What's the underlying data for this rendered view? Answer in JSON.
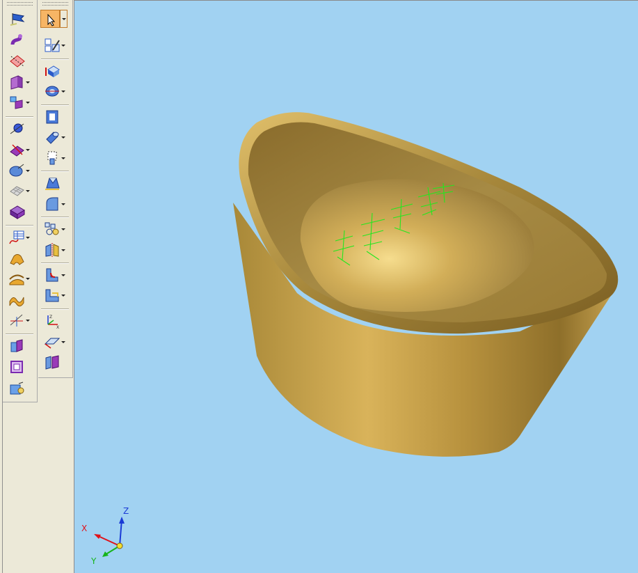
{
  "toolbar_left": {
    "tools": [
      {
        "name": "sketch-flag-icon"
      },
      {
        "name": "curve-tool-icon"
      },
      {
        "name": "plane-surface-icon"
      },
      {
        "name": "extrude-surface-icon"
      },
      {
        "name": "sweep-surface-icon"
      },
      {
        "name": "point-sphere-icon"
      },
      {
        "name": "trim-surface-icon"
      },
      {
        "name": "ellipsoid-icon"
      },
      {
        "name": "mesh-surface-icon"
      },
      {
        "name": "solid-block-icon"
      },
      {
        "name": "table-curve-icon"
      },
      {
        "name": "blend-surface-icon"
      },
      {
        "name": "offset-surface-icon"
      },
      {
        "name": "wave-surface-icon"
      },
      {
        "name": "line-construct-icon"
      },
      {
        "name": "split-face-icon"
      },
      {
        "name": "frame-face-icon"
      },
      {
        "name": "attach-face-icon"
      }
    ]
  },
  "toolbar_right": {
    "tools": [
      {
        "name": "select-arrow-icon"
      },
      {
        "name": "layout-sketch-icon"
      },
      {
        "name": "box-solid-icon"
      },
      {
        "name": "revolve-icon"
      },
      {
        "name": "shell-icon"
      },
      {
        "name": "cylinder-icon"
      },
      {
        "name": "hole-icon"
      },
      {
        "name": "loft-icon"
      },
      {
        "name": "draft-face-icon"
      },
      {
        "name": "pattern-icon"
      },
      {
        "name": "mirror-icon"
      },
      {
        "name": "fillet-corner-icon"
      },
      {
        "name": "chamfer-icon"
      },
      {
        "name": "coordinate-system-icon"
      },
      {
        "name": "datum-plane-icon"
      },
      {
        "name": "section-icon"
      }
    ]
  },
  "viewport": {
    "background": "#a1d2f2",
    "model": {
      "kind": "gold ingot",
      "color": "#c9a24d",
      "engraving_color": "#22e81e"
    }
  },
  "axis_triad": {
    "x_label": "X",
    "y_label": "Y",
    "z_label": "Z",
    "x_color": "#e0121a",
    "y_color": "#16b41a",
    "z_color": "#1a3ad6"
  }
}
